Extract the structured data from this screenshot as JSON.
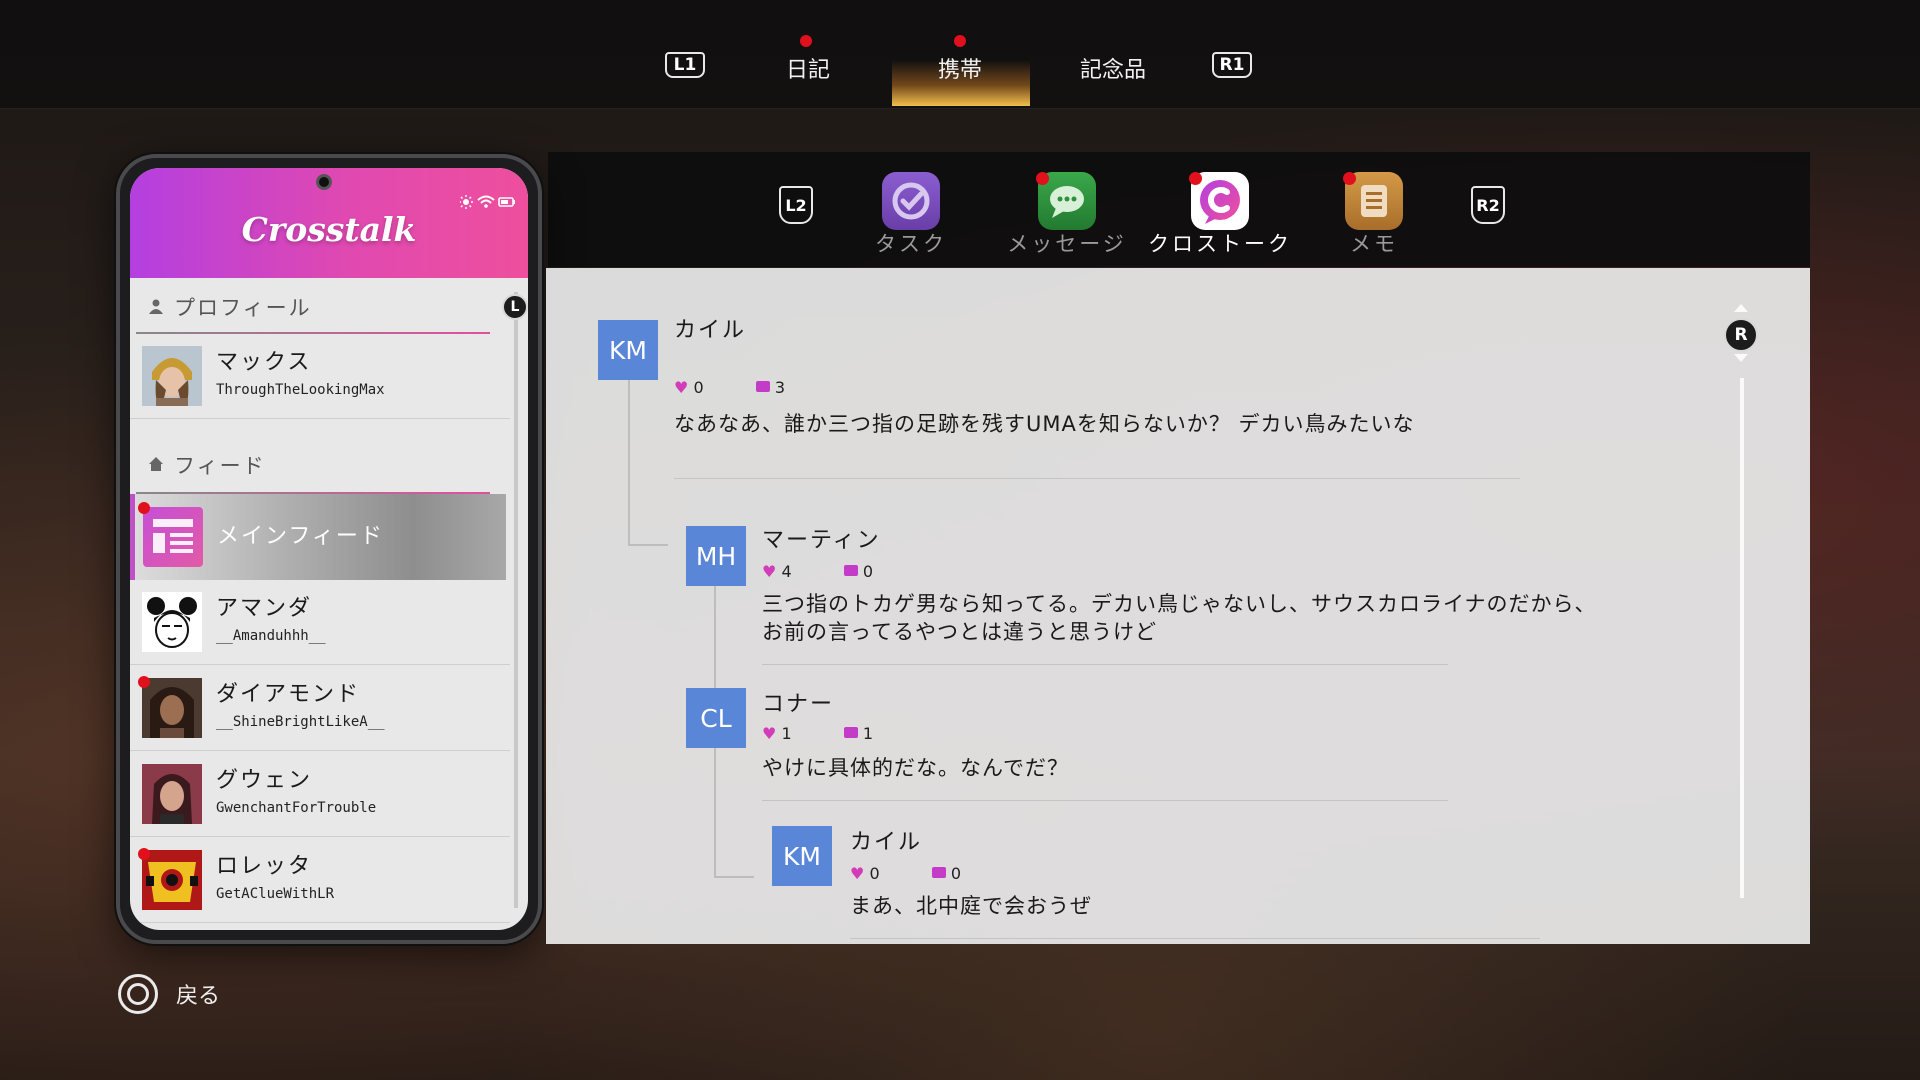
{
  "top_tabs": {
    "left_shoulder": "L1",
    "right_shoulder": "R1",
    "tabs": [
      {
        "label": "日記",
        "has_notification": true,
        "active": false
      },
      {
        "label": "携帯",
        "has_notification": true,
        "active": true
      },
      {
        "label": "記念品",
        "has_notification": false,
        "active": false
      }
    ]
  },
  "dock": {
    "left_shoulder": "L2",
    "right_shoulder": "R2",
    "apps": [
      {
        "label": "タスク",
        "icon": "task-check-icon",
        "color": "#7a4fb8",
        "has_notification": false,
        "active": false
      },
      {
        "label": "メッセージ",
        "icon": "message-bubble-icon",
        "color": "#2e8f3c",
        "has_notification": true,
        "active": false
      },
      {
        "label": "クロストーク",
        "icon": "crosstalk-logo-icon",
        "color": "#d9368f",
        "has_notification": true,
        "active": true
      },
      {
        "label": "メモ",
        "icon": "memo-icon",
        "color": "#c98a3a",
        "has_notification": true,
        "active": false
      }
    ]
  },
  "phone": {
    "app_title": "Crosstalk",
    "status_icons": [
      "brightness-icon",
      "wifi-icon",
      "battery-icon"
    ],
    "scroll_badge": "L",
    "profile_section": "プロフィール",
    "profile": {
      "name": "マックス",
      "handle": "ThroughTheLookingMax"
    },
    "feed_section": "フィード",
    "main_feed": {
      "label": "メインフィード",
      "has_notification": true
    },
    "contacts": [
      {
        "name": "アマンダ",
        "handle": "__Amanduhhh__",
        "has_notification": false
      },
      {
        "name": "ダイアモンド",
        "handle": "__ShineBrightLikeA__",
        "has_notification": true
      },
      {
        "name": "グウェン",
        "handle": "GwenchantForTrouble",
        "has_notification": false
      },
      {
        "name": "ロレッタ",
        "handle": "GetAClueWithLR",
        "has_notification": true
      }
    ]
  },
  "feed": {
    "scroll_badge": "R",
    "posts": [
      {
        "initials": "KM",
        "author": "カイル",
        "likes": "0",
        "comments": "3",
        "text": "なあなあ、誰か三つ指の足跡を残すUMAを知らないか？ デカい鳥みたいな"
      },
      {
        "initials": "MH",
        "author": "マーティン",
        "likes": "4",
        "comments": "0",
        "text": "三つ指のトカゲ男なら知ってる。デカい鳥じゃないし、サウスカロライナのだから、",
        "text2": "お前の言ってるやつとは違うと思うけど"
      },
      {
        "initials": "CL",
        "author": "コナー",
        "likes": "1",
        "comments": "1",
        "text": "やけに具体的だな。なんでだ？"
      },
      {
        "initials": "KM",
        "author": "カイル",
        "likes": "0",
        "comments": "0",
        "text": "まあ、北中庭で会おうぜ"
      }
    ]
  },
  "footer": {
    "back_label": "戻る",
    "back_button_icon": "circle-button-icon"
  }
}
